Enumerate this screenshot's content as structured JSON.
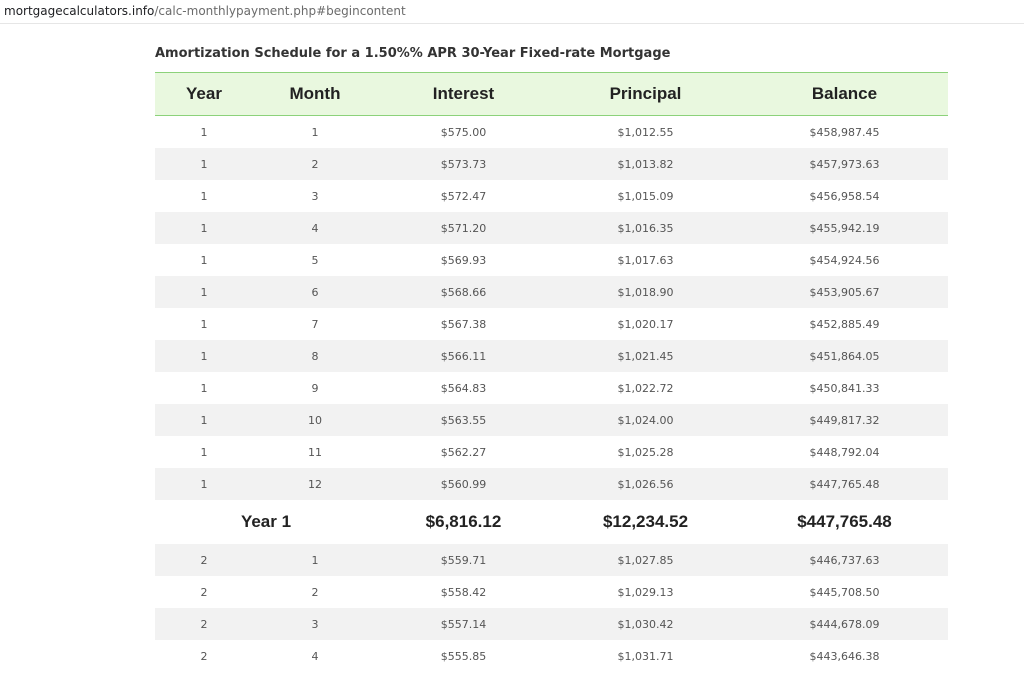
{
  "browser": {
    "url_host": "mortgagecalculators.info",
    "url_path": "/calc-monthlypayment.php#begincontent"
  },
  "page": {
    "title": "Amortization Schedule for a 1.50%% APR 30-Year Fixed-rate Mortgage"
  },
  "table": {
    "headers": [
      "Year",
      "Month",
      "Interest",
      "Principal",
      "Balance"
    ],
    "year1_rows": [
      [
        "1",
        "1",
        "$575.00",
        "$1,012.55",
        "$458,987.45"
      ],
      [
        "1",
        "2",
        "$573.73",
        "$1,013.82",
        "$457,973.63"
      ],
      [
        "1",
        "3",
        "$572.47",
        "$1,015.09",
        "$456,958.54"
      ],
      [
        "1",
        "4",
        "$571.20",
        "$1,016.35",
        "$455,942.19"
      ],
      [
        "1",
        "5",
        "$569.93",
        "$1,017.63",
        "$454,924.56"
      ],
      [
        "1",
        "6",
        "$568.66",
        "$1,018.90",
        "$453,905.67"
      ],
      [
        "1",
        "7",
        "$567.38",
        "$1,020.17",
        "$452,885.49"
      ],
      [
        "1",
        "8",
        "$566.11",
        "$1,021.45",
        "$451,864.05"
      ],
      [
        "1",
        "9",
        "$564.83",
        "$1,022.72",
        "$450,841.33"
      ],
      [
        "1",
        "10",
        "$563.55",
        "$1,024.00",
        "$449,817.32"
      ],
      [
        "1",
        "11",
        "$562.27",
        "$1,025.28",
        "$448,792.04"
      ],
      [
        "1",
        "12",
        "$560.99",
        "$1,026.56",
        "$447,765.48"
      ]
    ],
    "year1_summary": {
      "label": "Year 1",
      "interest": "$6,816.12",
      "principal": "$12,234.52",
      "balance": "$447,765.48"
    },
    "year2_rows": [
      [
        "2",
        "1",
        "$559.71",
        "$1,027.85",
        "$446,737.63"
      ],
      [
        "2",
        "2",
        "$558.42",
        "$1,029.13",
        "$445,708.50"
      ],
      [
        "2",
        "3",
        "$557.14",
        "$1,030.42",
        "$444,678.09"
      ],
      [
        "2",
        "4",
        "$555.85",
        "$1,031.71",
        "$443,646.38"
      ]
    ]
  }
}
